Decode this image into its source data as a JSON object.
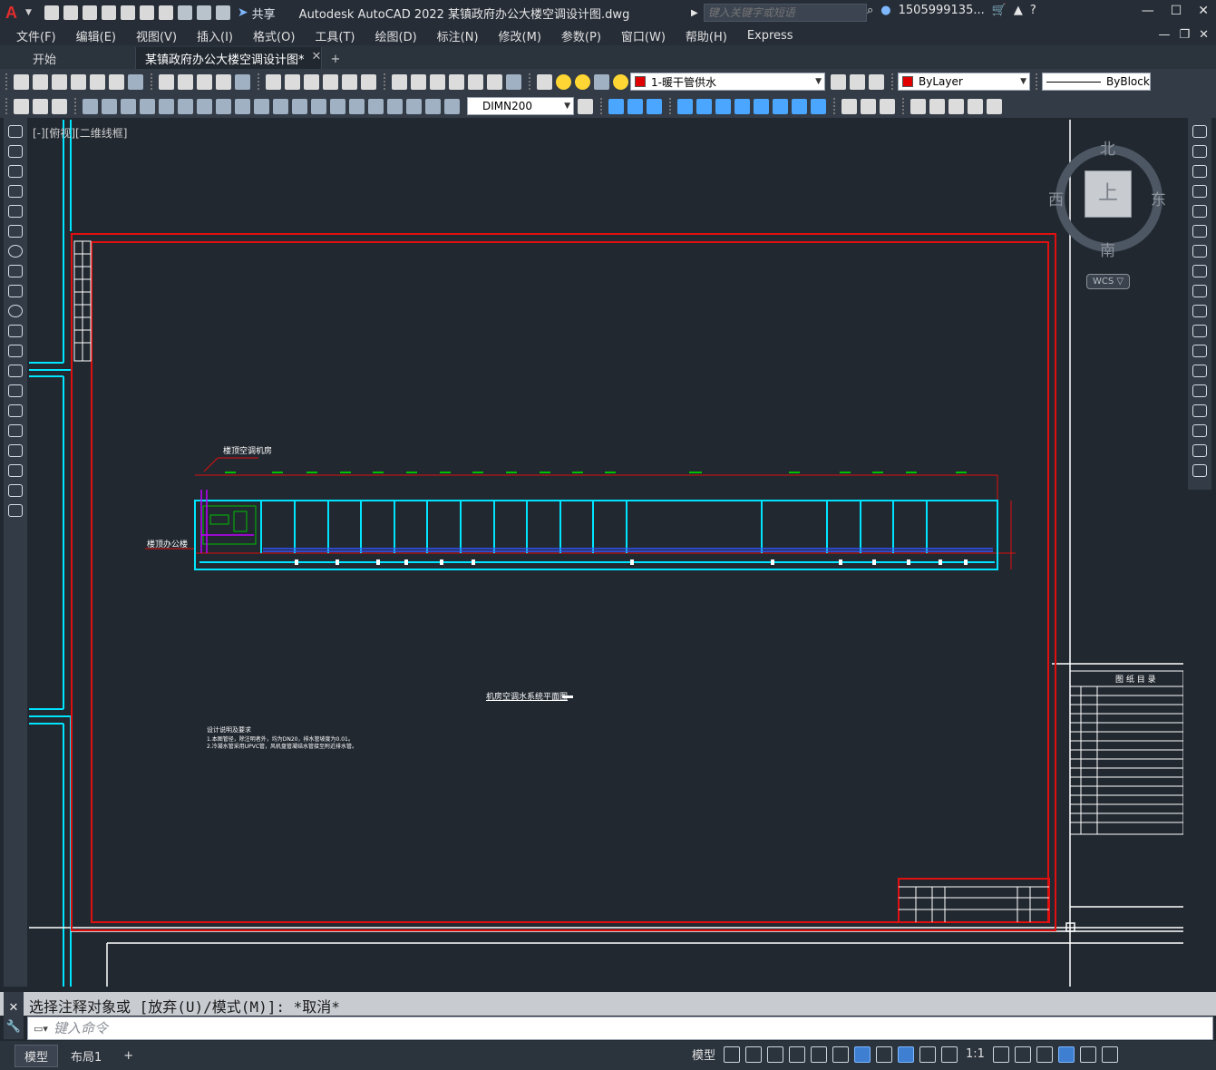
{
  "titlebar": {
    "logo": "A",
    "share": "共享",
    "app_title": "Autodesk AutoCAD 2022    某镇政府办公大楼空调设计图.dwg",
    "search_placeholder": "键入关键字或短语",
    "user": "1505999135...",
    "help": "?"
  },
  "menu": [
    "文件(F)",
    "编辑(E)",
    "视图(V)",
    "插入(I)",
    "格式(O)",
    "工具(T)",
    "绘图(D)",
    "标注(N)",
    "修改(M)",
    "参数(P)",
    "窗口(W)",
    "帮助(H)",
    "Express"
  ],
  "tabs": {
    "start": "开始",
    "active": "某镇政府办公大楼空调设计图*",
    "close": "✕",
    "add": "+"
  },
  "toolbar": {
    "layer_name": "1-暖干管供水",
    "color": "ByLayer",
    "linetype": "ByBlock",
    "dimstyle": "DIMN200",
    "layer_color": "#e00000"
  },
  "view": {
    "label": "[-][俯视][二维线框]",
    "cube_top": "上",
    "north": "北",
    "south": "南",
    "east": "东",
    "west": "西",
    "wcs": "WCS ▽"
  },
  "drawing": {
    "title": "机房空调水系统平面图",
    "label_left_top": "楼顶空调机房",
    "label_left": "楼顶办公楼",
    "notes_title": "设计说明及要求",
    "notes_line1": "1.本图管径，除注明者外，均为DN20，排水管坡度为0.01。",
    "notes_line2": "2.冷凝水管采用UPVC管，风机盘管凝结水管接至附近排水管。",
    "catalog_title": "图  纸  目  录",
    "colors": {
      "cyan": "#00e5ff",
      "red": "#e01010",
      "green": "#00c000",
      "white": "#ffffff",
      "magenta": "#c000ff"
    }
  },
  "command": {
    "history": "选择注释对象或 [放弃(U)/模式(M)]: *取消*",
    "placeholder": "键入命令"
  },
  "status": {
    "layout_model": "模型",
    "layout_1": "布局1",
    "model_btn": "模型",
    "scale": "1:1"
  }
}
